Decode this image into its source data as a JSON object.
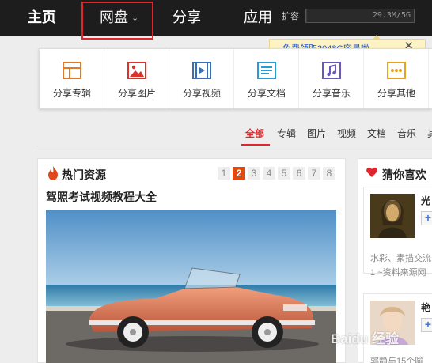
{
  "nav": {
    "home": "主页",
    "disk": "网盘",
    "share": "分享",
    "apps": "应用",
    "expand": "扩容",
    "storage": "29.3M/5G",
    "storage_used_fraction": 0.006
  },
  "promo": {
    "text": "免费领取2048G容量啦",
    "close": "✕"
  },
  "share_types": [
    {
      "label": "分享专辑",
      "icon": "album-icon"
    },
    {
      "label": "分享图片",
      "icon": "image-icon"
    },
    {
      "label": "分享视频",
      "icon": "video-icon"
    },
    {
      "label": "分享文档",
      "icon": "document-icon"
    },
    {
      "label": "分享音乐",
      "icon": "music-icon"
    },
    {
      "label": "分享其他",
      "icon": "more-icon"
    }
  ],
  "filters": [
    "全部",
    "专辑",
    "图片",
    "视频",
    "文档",
    "音乐",
    "其"
  ],
  "hot": {
    "title": "热门资源",
    "pages": [
      "1",
      "2",
      "3",
      "4",
      "5",
      "6",
      "7",
      "8"
    ],
    "active_page": "2",
    "item_title": "驾照考试视频教程大全"
  },
  "guess": {
    "title": "猜你喜欢",
    "items": [
      {
        "name": "光",
        "add": "+",
        "desc1": "水彩、素描交流",
        "desc2": "1 ~资料来源网"
      },
      {
        "name": "艳",
        "add": "+",
        "desc1": "郭静与15个喻",
        "desc2": ""
      }
    ]
  },
  "watermark": "Baidu 经验",
  "colors": {
    "accent": "#e0262a",
    "topbar": "#1d1d1d",
    "page_active": "#e04a10",
    "link": "#1e55c8"
  }
}
